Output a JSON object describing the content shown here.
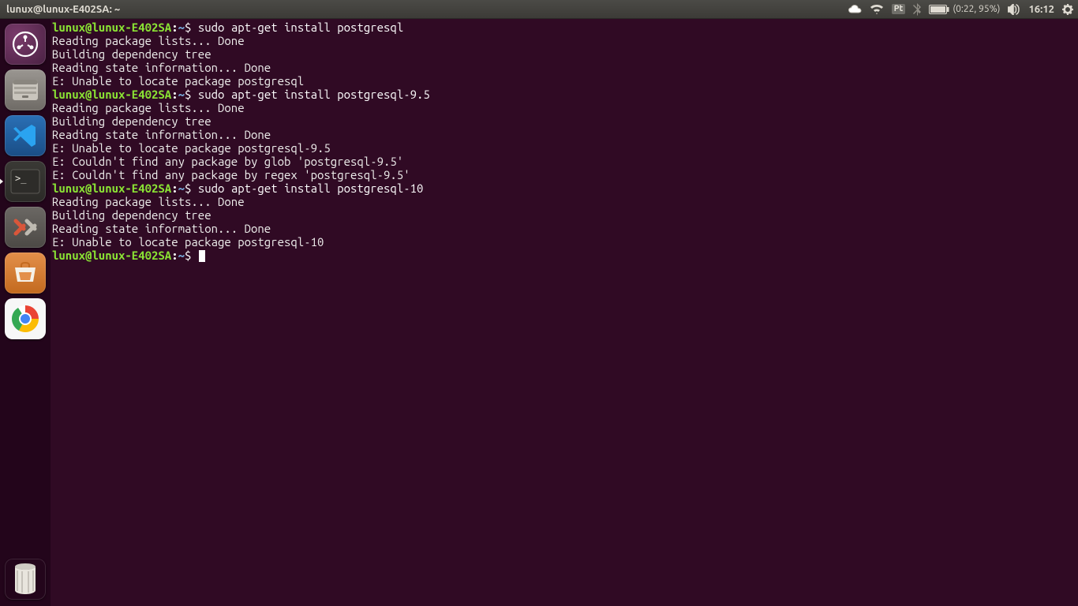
{
  "menubar": {
    "title": "lunux@lunux-E402SA: ~",
    "keyboard_layout": "Pt",
    "battery_text": "(0:22, 95%)",
    "clock": "16:12"
  },
  "launcher": {
    "items": [
      {
        "name": "dash-icon",
        "active": false
      },
      {
        "name": "files-icon",
        "active": false
      },
      {
        "name": "vscode-icon",
        "active": false
      },
      {
        "name": "terminal-icon",
        "active": true
      },
      {
        "name": "settings-icon",
        "active": false
      },
      {
        "name": "software-icon",
        "active": false
      },
      {
        "name": "chrome-icon",
        "active": false
      }
    ],
    "trash": {
      "name": "trash-icon"
    }
  },
  "prompt": {
    "user_host": "lunux@lunux-E402SA",
    "sep": ":",
    "path": "~",
    "dollar": "$ "
  },
  "session": [
    {
      "type": "cmd",
      "text": "sudo apt-get install postgresql"
    },
    {
      "type": "out",
      "text": "Reading package lists... Done"
    },
    {
      "type": "out",
      "text": "Building dependency tree"
    },
    {
      "type": "out",
      "text": "Reading state information... Done"
    },
    {
      "type": "out",
      "text": "E: Unable to locate package postgresql"
    },
    {
      "type": "cmd",
      "text": "sudo apt-get install postgresql-9.5"
    },
    {
      "type": "out",
      "text": "Reading package lists... Done"
    },
    {
      "type": "out",
      "text": "Building dependency tree"
    },
    {
      "type": "out",
      "text": "Reading state information... Done"
    },
    {
      "type": "out",
      "text": "E: Unable to locate package postgresql-9.5"
    },
    {
      "type": "out",
      "text": "E: Couldn't find any package by glob 'postgresql-9.5'"
    },
    {
      "type": "out",
      "text": "E: Couldn't find any package by regex 'postgresql-9.5'"
    },
    {
      "type": "cmd",
      "text": "sudo apt-get install postgresql-10"
    },
    {
      "type": "out",
      "text": "Reading package lists... Done"
    },
    {
      "type": "out",
      "text": "Building dependency tree"
    },
    {
      "type": "out",
      "text": "Reading state information... Done"
    },
    {
      "type": "out",
      "text": "E: Unable to locate package postgresql-10"
    },
    {
      "type": "cmd",
      "text": "",
      "cursor": true
    }
  ]
}
